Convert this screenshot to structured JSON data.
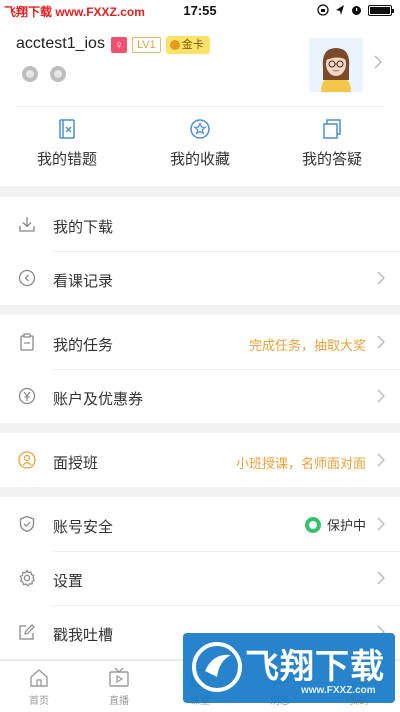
{
  "status_bar": {
    "carrier": "飞翔下载 www.FXXZ.com",
    "time": "17:55"
  },
  "profile": {
    "username": "acctest1_ios",
    "gender_badge": "♀",
    "level": "LV1",
    "membership": "金卡"
  },
  "quick_links": [
    {
      "label": "我的错题",
      "icon": "wrong-questions-icon"
    },
    {
      "label": "我的收藏",
      "icon": "star-icon"
    },
    {
      "label": "我的答疑",
      "icon": "qa-icon"
    }
  ],
  "menu": {
    "downloads": {
      "label": "我的下载",
      "icon": "download-icon"
    },
    "history": {
      "label": "看课记录",
      "icon": "history-icon"
    },
    "tasks": {
      "label": "我的任务",
      "icon": "clipboard-icon",
      "hint": "完成任务，抽取大奖"
    },
    "account_coupons": {
      "label": "账户及优惠券",
      "icon": "yuan-icon"
    },
    "classes": {
      "label": "面授班",
      "icon": "person-icon",
      "hint": "小班授课，名师面对面"
    },
    "security": {
      "label": "账号安全",
      "icon": "shield-icon",
      "status": "保护中"
    },
    "settings": {
      "label": "设置",
      "icon": "gear-icon"
    },
    "feedback": {
      "label": "戳我吐槽",
      "icon": "edit-icon"
    }
  },
  "tabs": [
    {
      "label": "首页",
      "icon": "home-icon",
      "active": false
    },
    {
      "label": "直播",
      "icon": "tv-icon",
      "active": false
    },
    {
      "label": "课堂",
      "icon": "classroom-icon",
      "active": false
    },
    {
      "label": "消息",
      "icon": "message-icon",
      "active": false
    },
    {
      "label": "我的",
      "icon": "profile-icon",
      "active": true
    }
  ],
  "watermark": {
    "title": "飞翔下载",
    "url": "www.FXXZ.com"
  },
  "colors": {
    "accent": "#f5a623",
    "quick_icon": "#4a8fd0",
    "hint": "#e8a23a",
    "protect": "#35c16b",
    "female": "#f0506e"
  }
}
